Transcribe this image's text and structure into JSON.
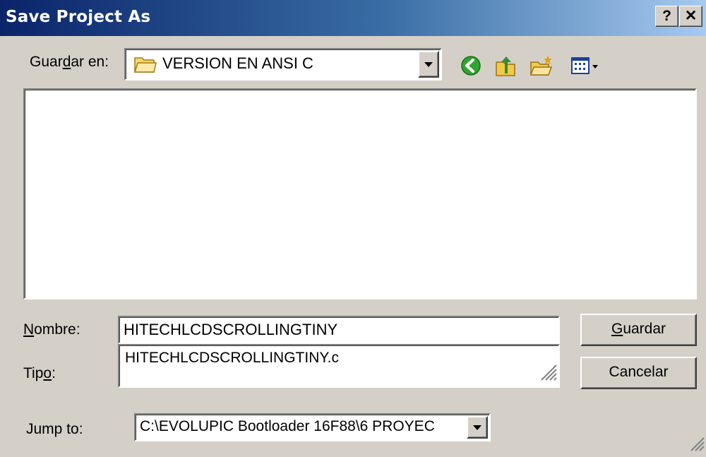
{
  "window": {
    "title": "Save Project As",
    "help_button": "?",
    "close_button": "✕"
  },
  "toolbar": {
    "save_in_label_pre": "Guar",
    "save_in_label_key": "d",
    "save_in_label_post": "ar en:",
    "save_in_value": "VERSION EN ANSI C",
    "icons": [
      "back-icon",
      "up-folder-icon",
      "new-folder-icon",
      "view-menu-icon"
    ]
  },
  "file_list": {
    "items": []
  },
  "form": {
    "name_label_key": "N",
    "name_label_rest": "ombre:",
    "name_value": "HITECHLCDSCROLLINGTINY",
    "type_label_pre": "Tip",
    "type_label_key": "o",
    "type_label_post": ":",
    "type_value": "HITECHLCDSCROLLINGTINY.c",
    "jump_label": "Jump to:",
    "jump_value": "C:\\EVOLUPIC Bootloader 16F88\\6 PROYEC"
  },
  "buttons": {
    "save_key": "G",
    "save_rest": "uardar",
    "cancel": "Cancelar"
  },
  "colors": {
    "title_gradient_start": "#0a246a",
    "title_gradient_end": "#a6caf0",
    "face": "#d4d0c8"
  }
}
